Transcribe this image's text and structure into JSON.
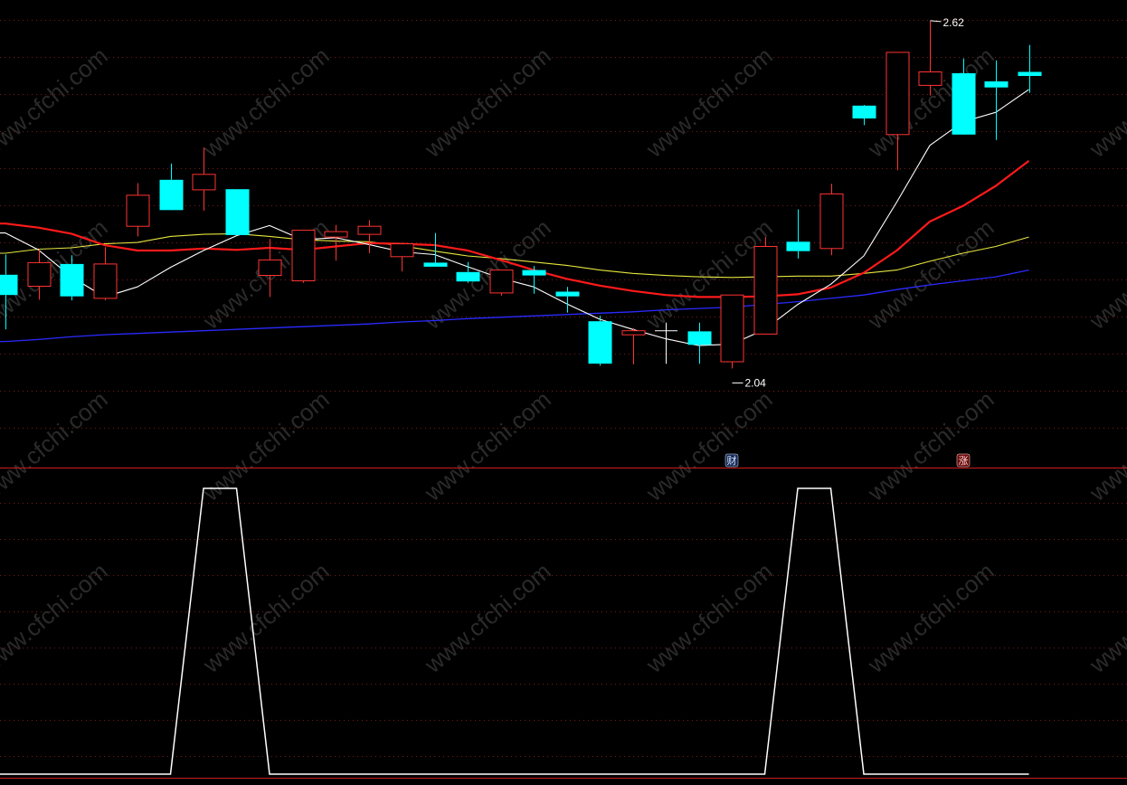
{
  "colors": {
    "background": "#000000",
    "up": "#ff3333",
    "down": "#00ffff",
    "grid": "#7a1a1a",
    "divider": "#cc1c1c",
    "ma5": "#ffffff",
    "ma10": "#ff1a1a",
    "ma20": "#e6e640",
    "ma60": "#2a2aff",
    "indicator": "#ffffff",
    "label": "#ffffff",
    "watermark": "#2a2a2a",
    "marker_cai_bg": "#1a2a55",
    "marker_cai_fg": "#cfe4ff",
    "marker_zhang_bg": "#6a0a0a",
    "marker_zhang_fg": "#ffdddd"
  },
  "watermark": "www.cfchi.com",
  "chart_data": [
    {
      "type": "candlestick",
      "panel": "price",
      "annotations": {
        "high_label": "2.62",
        "low_label": "2.04"
      },
      "markers": {
        "cai": "财",
        "zhang": "涨"
      },
      "ylim": [
        2.02,
        2.64
      ],
      "candles": [
        {
          "o": 2.243,
          "h": 2.273,
          "l": 2.162,
          "c": 2.213
        },
        {
          "o": 2.226,
          "h": 2.281,
          "l": 2.206,
          "c": 2.261
        },
        {
          "o": 2.259,
          "h": 2.272,
          "l": 2.205,
          "c": 2.211
        },
        {
          "o": 2.208,
          "h": 2.284,
          "l": 2.205,
          "c": 2.259
        },
        {
          "o": 2.315,
          "h": 2.379,
          "l": 2.3,
          "c": 2.361
        },
        {
          "o": 2.384,
          "h": 2.408,
          "l": 2.355,
          "c": 2.339
        },
        {
          "o": 2.369,
          "h": 2.432,
          "l": 2.338,
          "c": 2.392
        },
        {
          "o": 2.37,
          "h": 2.37,
          "l": 2.302,
          "c": 2.302
        },
        {
          "o": 2.242,
          "h": 2.296,
          "l": 2.21,
          "c": 2.265
        },
        {
          "o": 2.234,
          "h": 2.309,
          "l": 2.231,
          "c": 2.309
        },
        {
          "o": 2.299,
          "h": 2.317,
          "l": 2.264,
          "c": 2.307
        },
        {
          "o": 2.303,
          "h": 2.324,
          "l": 2.275,
          "c": 2.315
        },
        {
          "o": 2.27,
          "h": 2.281,
          "l": 2.248,
          "c": 2.289
        },
        {
          "o": 2.261,
          "h": 2.305,
          "l": 2.255,
          "c": 2.255
        },
        {
          "o": 2.247,
          "h": 2.262,
          "l": 2.231,
          "c": 2.233
        },
        {
          "o": 2.216,
          "h": 2.247,
          "l": 2.212,
          "c": 2.25
        },
        {
          "o": 2.25,
          "h": 2.256,
          "l": 2.215,
          "c": 2.242
        },
        {
          "o": 2.218,
          "h": 2.225,
          "l": 2.187,
          "c": 2.211
        },
        {
          "o": 2.174,
          "h": 2.182,
          "l": 2.108,
          "c": 2.111
        },
        {
          "o": 2.154,
          "h": 2.164,
          "l": 2.11,
          "c": 2.16
        },
        {
          "o": 2.16,
          "h": 2.172,
          "l": 2.111,
          "c": 2.16
        },
        {
          "o": 2.159,
          "h": 2.172,
          "l": 2.111,
          "c": 2.139
        },
        {
          "o": 2.114,
          "h": 2.211,
          "l": 2.104,
          "c": 2.213
        },
        {
          "o": 2.155,
          "h": 2.299,
          "l": 2.156,
          "c": 2.285
        },
        {
          "o": 2.292,
          "h": 2.34,
          "l": 2.267,
          "c": 2.278
        },
        {
          "o": 2.282,
          "h": 2.378,
          "l": 2.272,
          "c": 2.363
        },
        {
          "o": 2.494,
          "h": 2.495,
          "l": 2.465,
          "c": 2.475
        },
        {
          "o": 2.451,
          "h": 2.477,
          "l": 2.398,
          "c": 2.573
        },
        {
          "o": 2.524,
          "h": 2.62,
          "l": 2.509,
          "c": 2.544
        },
        {
          "o": 2.542,
          "h": 2.564,
          "l": 2.468,
          "c": 2.451
        },
        {
          "o": 2.53,
          "h": 2.561,
          "l": 2.443,
          "c": 2.521
        },
        {
          "o": 2.544,
          "h": 2.584,
          "l": 2.513,
          "c": 2.538
        }
      ],
      "ma5": [
        2.305,
        2.28,
        2.24,
        2.21,
        2.225,
        2.254,
        2.279,
        2.301,
        2.316,
        2.295,
        2.298,
        2.288,
        2.277,
        2.273,
        2.255,
        2.238,
        2.225,
        2.2,
        2.177,
        2.162,
        2.148,
        2.138,
        2.14,
        2.162,
        2.199,
        2.229,
        2.271,
        2.351,
        2.435,
        2.47,
        2.484,
        2.518
      ],
      "ma10": [
        2.319,
        2.313,
        2.304,
        2.287,
        2.279,
        2.279,
        2.282,
        2.28,
        2.283,
        2.28,
        2.285,
        2.29,
        2.289,
        2.287,
        2.279,
        2.265,
        2.25,
        2.237,
        2.227,
        2.219,
        2.213,
        2.21,
        2.21,
        2.211,
        2.214,
        2.224,
        2.246,
        2.279,
        2.322,
        2.345,
        2.375,
        2.412
      ],
      "ma20": [
        2.275,
        2.281,
        2.283,
        2.289,
        2.291,
        2.3,
        2.303,
        2.304,
        2.3,
        2.295,
        2.293,
        2.292,
        2.286,
        2.278,
        2.271,
        2.267,
        2.262,
        2.257,
        2.25,
        2.245,
        2.242,
        2.24,
        2.239,
        2.24,
        2.241,
        2.241,
        2.245,
        2.25,
        2.263,
        2.275,
        2.285,
        2.299
      ],
      "ma60": [
        2.144,
        2.147,
        2.151,
        2.154,
        2.156,
        2.158,
        2.16,
        2.162,
        2.164,
        2.166,
        2.168,
        2.17,
        2.173,
        2.175,
        2.178,
        2.18,
        2.182,
        2.184,
        2.186,
        2.188,
        2.191,
        2.193,
        2.195,
        2.199,
        2.203,
        2.208,
        2.213,
        2.221,
        2.228,
        2.234,
        2.24,
        2.25
      ]
    },
    {
      "type": "line",
      "panel": "indicator",
      "ylim": [
        0,
        1
      ],
      "values": [
        0,
        0,
        0,
        0,
        0,
        0,
        1,
        1,
        0,
        0,
        0,
        0,
        0,
        0,
        0,
        0,
        0,
        0,
        0,
        0,
        0,
        0,
        0,
        0,
        1,
        1,
        0,
        0,
        0,
        0,
        0,
        0
      ]
    }
  ]
}
